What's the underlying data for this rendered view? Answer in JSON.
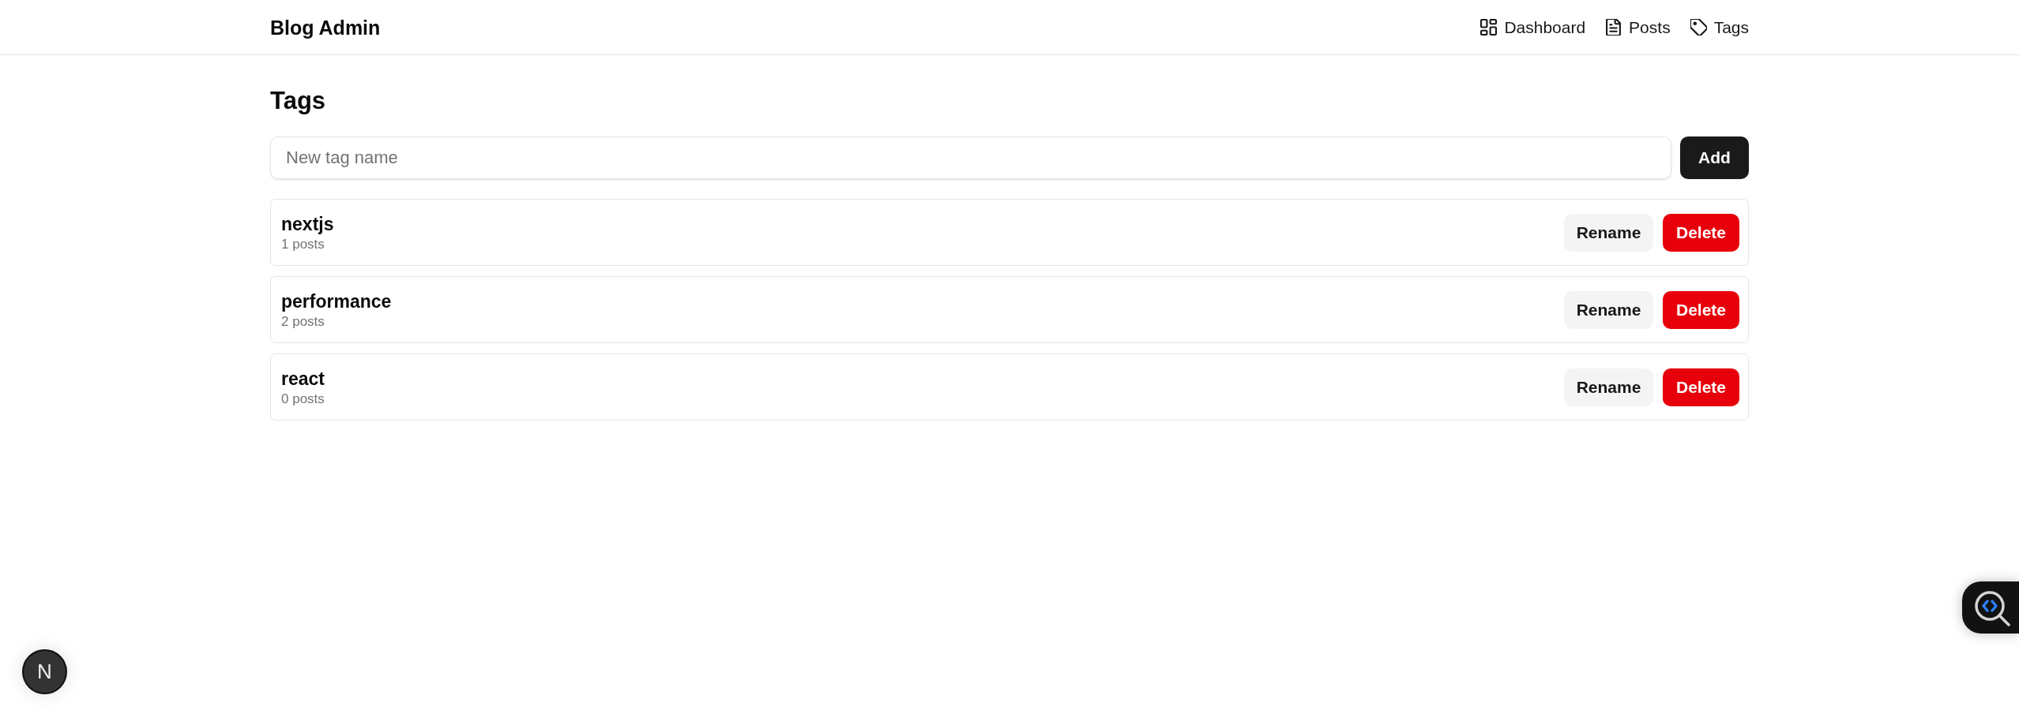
{
  "header": {
    "brand": "Blog Admin",
    "nav": [
      {
        "label": "Dashboard",
        "kind": "dashboard"
      },
      {
        "label": "Posts",
        "kind": "posts"
      },
      {
        "label": "Tags",
        "kind": "tags"
      }
    ]
  },
  "page": {
    "title": "Tags"
  },
  "new_tag_form": {
    "placeholder": "New tag name",
    "button": "Add"
  },
  "tags": [
    {
      "name": "nextjs",
      "count": "1 posts",
      "actions": [
        {
          "label": "Rename",
          "kind": "secondary"
        },
        {
          "label": "Delete",
          "kind": "danger"
        }
      ]
    },
    {
      "name": "performance",
      "count": "2 posts",
      "actions": [
        {
          "label": "Rename",
          "kind": "secondary"
        },
        {
          "label": "Delete",
          "kind": "danger"
        }
      ]
    },
    {
      "name": "react",
      "count": "0 posts",
      "actions": [
        {
          "label": "Rename",
          "kind": "secondary"
        },
        {
          "label": "Delete",
          "kind": "danger"
        }
      ]
    }
  ],
  "dev_indicator": {
    "logo": "N"
  }
}
